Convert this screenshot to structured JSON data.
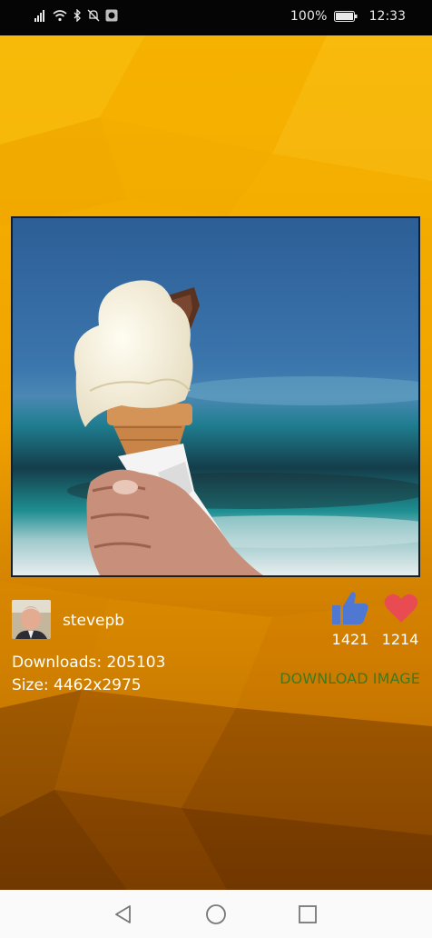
{
  "status_bar": {
    "battery": "100%",
    "time": "12:33",
    "icons": [
      "signal-icon",
      "wifi-icon",
      "bluetooth-icon",
      "mute-icon",
      "screenshot-icon",
      "battery-icon"
    ]
  },
  "image": {
    "subject": "ice-cream-cone-photo"
  },
  "author": {
    "username": "stevepb"
  },
  "stats": {
    "downloads_label": "Downloads: 205103",
    "size_label": "Size: 4462x2975",
    "likes": "1421",
    "favorites": "1214"
  },
  "actions": {
    "download_label": "DOWNLOAD IMAGE"
  },
  "colors": {
    "background_accent": "#f3a400",
    "like_icon": "#4f78d2",
    "favorite_icon": "#e84c52",
    "download_text": "#3d7a1f"
  },
  "nav_bar": {
    "items": [
      "back-icon",
      "home-icon",
      "recents-icon"
    ]
  }
}
